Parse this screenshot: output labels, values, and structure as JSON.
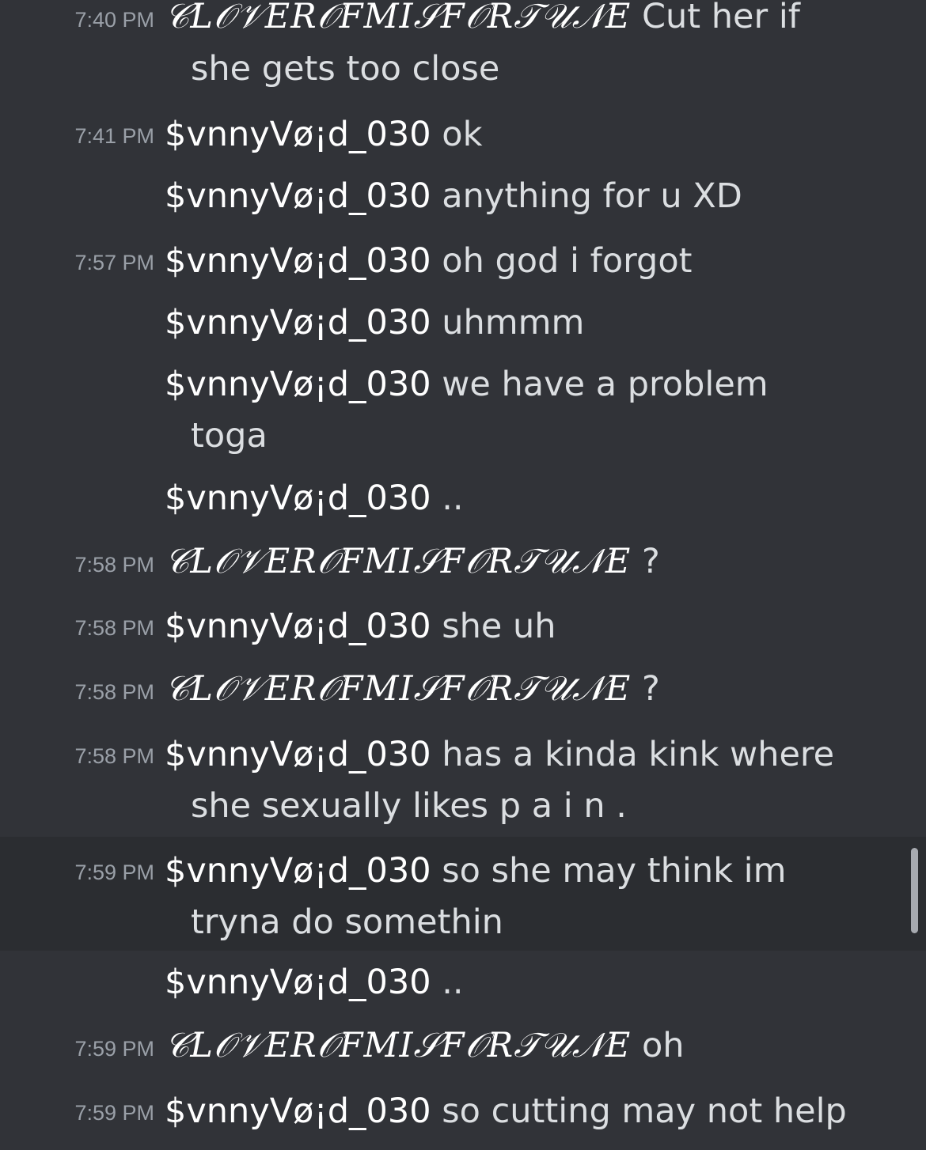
{
  "messages": [
    {
      "time": "7:40 PM",
      "user": "𝒞𝐿𝒪𝒱𝐸𝑅𝒪𝐹𝑀𝐼𝒮𝐹𝒪𝑅𝒯𝒰𝒩𝐸",
      "text": "Cut her if",
      "cont": "she gets too close"
    },
    {
      "time": "7:41 PM",
      "user": "$vnnyVø¡d_030",
      "text": "ok"
    },
    {
      "time": "",
      "user": "$vnnyVø¡d_030",
      "text": "anything for u XD"
    },
    {
      "time": "7:57 PM",
      "user": "$vnnyVø¡d_030",
      "text": "oh god i forgot"
    },
    {
      "time": "",
      "user": "$vnnyVø¡d_030",
      "text": "uhmmm"
    },
    {
      "time": "",
      "user": "$vnnyVø¡d_030",
      "text": "we have a problem",
      "cont": "toga"
    },
    {
      "time": "",
      "user": "$vnnyVø¡d_030",
      "text": ".."
    },
    {
      "time": "7:58 PM",
      "user": "𝒞𝐿𝒪𝒱𝐸𝑅𝒪𝐹𝑀𝐼𝒮𝐹𝒪𝑅𝒯𝒰𝒩𝐸",
      "text": "?"
    },
    {
      "time": "7:58 PM",
      "user": "$vnnyVø¡d_030",
      "text": "she uh"
    },
    {
      "time": "7:58 PM",
      "user": "𝒞𝐿𝒪𝒱𝐸𝑅𝒪𝐹𝑀𝐼𝒮𝐹𝒪𝑅𝒯𝒰𝒩𝐸",
      "text": "?"
    },
    {
      "time": "7:58 PM",
      "user": "$vnnyVø¡d_030",
      "text": "has a kinda kink where",
      "cont": "she sexually likes p a i n ."
    },
    {
      "time": "7:59 PM",
      "user": "$vnnyVø¡d_030",
      "text": "so she may think im",
      "cont": "tryna do somethin"
    },
    {
      "time": "",
      "user": "$vnnyVø¡d_030",
      "text": ".."
    },
    {
      "time": "7:59 PM",
      "user": "𝒞𝐿𝒪𝒱𝐸𝑅𝒪𝐹𝑀𝐼𝒮𝐹𝒪𝑅𝒯𝒰𝒩𝐸",
      "text": "oh"
    },
    {
      "time": "7:59 PM",
      "user": "$vnnyVø¡d_030",
      "text": "so cutting may not help"
    }
  ],
  "colors": {
    "background": "#313338",
    "highlight": "#2b2d31",
    "timestamp": "#9aa0a8",
    "username": "#ffffff",
    "text": "#dbdee1"
  }
}
